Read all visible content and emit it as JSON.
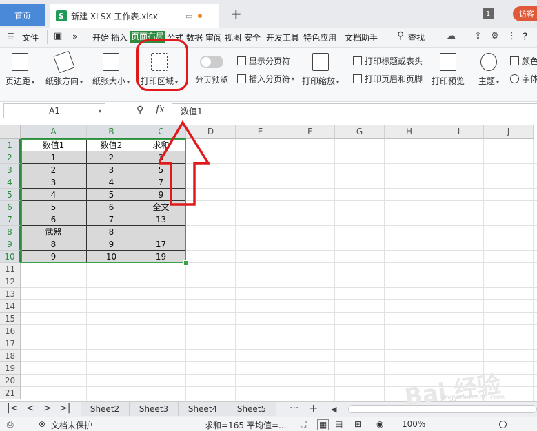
{
  "titlebar": {
    "home_tab": "首页",
    "file_tab": "新建 XLSX 工作表.xlsx",
    "file_icon": "S",
    "new_tab": "+",
    "window_count": "1",
    "visitor": "访客"
  },
  "menu": {
    "file": "文件",
    "more": "»",
    "items": [
      "开始",
      "插入",
      "页面布局",
      "公式",
      "数据",
      "审阅",
      "视图",
      "安全",
      "开发工具",
      "特色应用",
      "文档助手"
    ],
    "active": "页面布局",
    "search": "查找",
    "help": "?"
  },
  "ribbon": {
    "margin": "页边距",
    "orientation": "纸张方向",
    "size": "纸张大小",
    "print_area": "打印区域",
    "page_break_preview": "分页预览",
    "show_page_break": "显示分页符",
    "insert_page_break": "插入分页符",
    "print_scale": "打印缩放",
    "print_titles": "打印标题或表头",
    "print_header_footer": "打印页眉和页脚",
    "print_preview": "打印预览",
    "theme": "主题",
    "color": "颜色",
    "font": "字体"
  },
  "formula_bar": {
    "name_box": "A1",
    "fx": "fx",
    "formula": "数值1"
  },
  "grid": {
    "columns": [
      "A",
      "B",
      "C",
      "D",
      "E",
      "F",
      "G",
      "H",
      "I",
      "J"
    ],
    "rows": [
      "1",
      "2",
      "3",
      "4",
      "5",
      "6",
      "7",
      "8",
      "9",
      "10",
      "11",
      "12",
      "13",
      "14",
      "15",
      "16",
      "17",
      "18",
      "19",
      "20",
      "21"
    ],
    "cells": [
      [
        "数值1",
        "数值2",
        "求和"
      ],
      [
        "1",
        "2",
        "3"
      ],
      [
        "2",
        "3",
        "5"
      ],
      [
        "3",
        "4",
        "7"
      ],
      [
        "4",
        "5",
        "9"
      ],
      [
        "5",
        "6",
        "全文"
      ],
      [
        "6",
        "7",
        "13"
      ],
      [
        "武器",
        "8",
        ""
      ],
      [
        "8",
        "9",
        "17"
      ],
      [
        "9",
        "10",
        "19"
      ]
    ]
  },
  "sheets": {
    "nav": [
      "|<",
      "<",
      ">",
      ">|"
    ],
    "tabs": [
      "Sheet2",
      "Sheet3",
      "Sheet4",
      "Sheet5"
    ],
    "more": "···",
    "add": "+"
  },
  "status": {
    "protection": "文档未保护",
    "sum": "求和=165",
    "avg": "平均值=...",
    "zoom": "100%"
  },
  "watermark": "Bai 经验",
  "watermark_url": "jingyan.baidu.com",
  "colors": {
    "accent_green": "#2e8b3e",
    "home_tab_blue": "#4a88d8",
    "annotation_red": "#e01a1a"
  }
}
